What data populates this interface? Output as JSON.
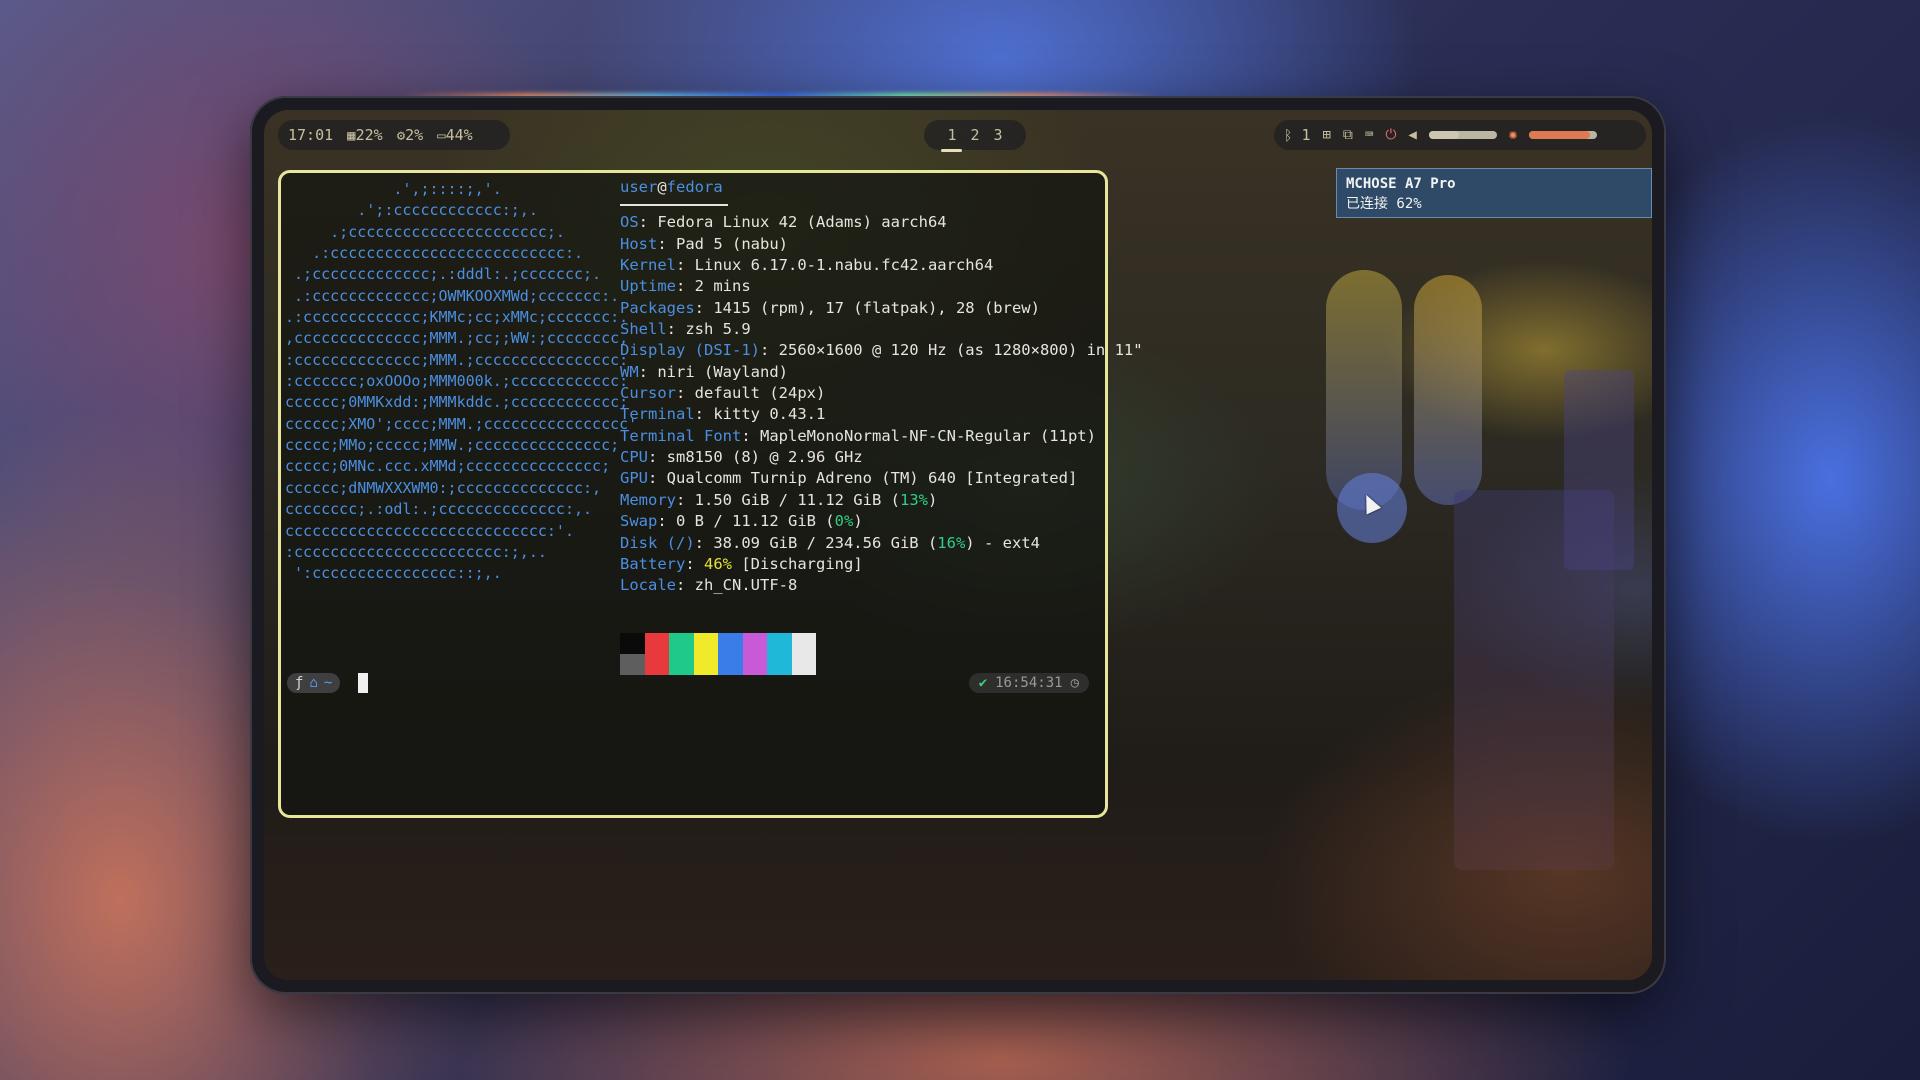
{
  "topbar": {
    "clock": "17:01",
    "memory": "22%",
    "cpu": "2%",
    "battery": "44%",
    "workspaces": [
      "1",
      "2",
      "3"
    ],
    "active_workspace_index": 0,
    "bluetooth_count": "1",
    "volume_level": 0.45,
    "brightness_level": 0.9,
    "icons": [
      "memory-icon",
      "cpu-icon",
      "battery-icon",
      "bluetooth-icon",
      "network-icon",
      "display-icon",
      "keyboard-icon",
      "power-icon",
      "volume-icon",
      "brightness-icon"
    ]
  },
  "notification": {
    "title": "MCHOSE A7 Pro",
    "body": "已连接 62%"
  },
  "terminal": {
    "logo_lines": [
      "            .',;::::;,'.",
      "        .';:cccccccccccc:;,.",
      "     .;cccccccccccccccccccccc;.",
      "   .:cccccccccccccccccccccccccc:.",
      " .;ccccccccccccc;.:dddl:.;ccccccc;.",
      " .:ccccccccccccc;OWMKOOXMWd;ccccccc:.",
      ".:ccccccccccccc;KMMc;cc;xMMc;ccccccc:.",
      ",cccccccccccccc;MMM.;cc;;WW:;cccccccc,",
      ":cccccccccccccc;MMM.;cccccccccccccccc:",
      ":ccccccc;oxOOOo;MMM000k.;cccccccccccc:",
      "cccccc;0MMKxdd:;MMMkddc.;cccccccccccc;",
      "cccccc;XMO';cccc;MMM.;cccccccccccccccc'",
      "ccccc;MMo;ccccc;MMW.;ccccccccccccccc;",
      "ccccc;0MNc.ccc.xMMd;ccccccccccccccc;",
      "cccccc;dNMWXXXWM0:;cccccccccccccc:,",
      "cccccccc;.:odl:.;cccccccccccccc:,.",
      "ccccccccccccccccccccccccccccc:'.",
      ":ccccccccccccccccccccccc:;,..",
      " ':cccccccccccccccc::;,."
    ],
    "user": "user",
    "at": "@",
    "host": "fedora",
    "info": [
      {
        "key": "OS",
        "value": "Fedora Linux 42 (Adams) aarch64"
      },
      {
        "key": "Host",
        "value": "Pad 5 (nabu)"
      },
      {
        "key": "Kernel",
        "value": "Linux 6.17.0-1.nabu.fc42.aarch64"
      },
      {
        "key": "Uptime",
        "value": "2 mins"
      },
      {
        "key": "Packages",
        "value": "1415 (rpm), 17 (flatpak), 28 (brew)"
      },
      {
        "key": "Shell",
        "value": "zsh 5.9"
      },
      {
        "key": "Display (DSI-1)",
        "value": "2560×1600 @ 120 Hz (as 1280×800) in 11\""
      },
      {
        "key": "WM",
        "value": "niri (Wayland)"
      },
      {
        "key": "Cursor",
        "value": "default (24px)"
      },
      {
        "key": "Terminal",
        "value": "kitty 0.43.1"
      },
      {
        "key": "Terminal Font",
        "value": "MapleMonoNormal-NF-CN-Regular (11pt)"
      },
      {
        "key": "CPU",
        "value": "sm8150 (8) @ 2.96 GHz"
      },
      {
        "key": "GPU",
        "value": "Qualcomm Turnip Adreno (TM) 640 [Integrated]"
      }
    ],
    "memory": {
      "key": "Memory",
      "pre": "1.50 GiB / 11.12 GiB (",
      "pct": "13%",
      "post": ")"
    },
    "swap": {
      "key": "Swap",
      "pre": "0 B / 11.12 GiB (",
      "pct": "0%",
      "post": ")"
    },
    "disk": {
      "key": "Disk (/)",
      "pre": "38.09 GiB / 234.56 GiB (",
      "pct": "16%",
      "post": ") - ext4"
    },
    "battery": {
      "key": "Battery",
      "pct": "46%",
      "post": " [Discharging]"
    },
    "locale": {
      "key": "Locale",
      "value": "zh_CN.UTF-8"
    },
    "palette": [
      {
        "top": "#0a0a0a",
        "bottom": "#5e5e5e"
      },
      {
        "top": "#e8393c",
        "bottom": "#e8393c"
      },
      {
        "top": "#1fc98a",
        "bottom": "#1fc98a"
      },
      {
        "top": "#f0ea2a",
        "bottom": "#f0ea2a"
      },
      {
        "top": "#3a7de8",
        "bottom": "#3a7de8"
      },
      {
        "top": "#c85ad8",
        "bottom": "#c85ad8"
      },
      {
        "top": "#1fb8d8",
        "bottom": "#1fb8d8"
      },
      {
        "top": "#e8e8e8",
        "bottom": "#e8e8e8"
      }
    ],
    "prompt": {
      "home_glyph": "⌂",
      "dir": "~"
    },
    "right_prompt": {
      "status": "✔",
      "time": "16:54:31"
    }
  },
  "colors": {
    "accent_border": "#e8e69a",
    "key_blue": "#4b8fe0",
    "pct_green": "#2fcf85",
    "battery_yellow": "#e4e23a"
  }
}
